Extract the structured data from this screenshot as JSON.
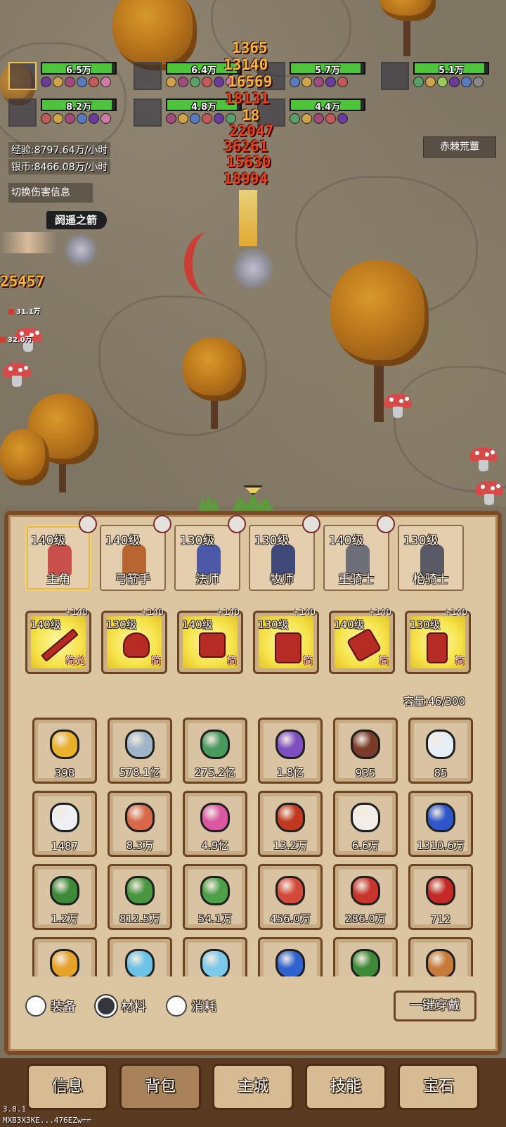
{
  "heroes": [
    {
      "hp": "6.5万",
      "fill": 0.95,
      "selected": true
    },
    {
      "hp": "6.4万",
      "fill": 0.95,
      "selected": false
    },
    {
      "hp": "5.7万",
      "fill": 0.95,
      "selected": false
    },
    {
      "hp": "5.1万",
      "fill": 0.95,
      "selected": false
    },
    {
      "hp": "8.2万",
      "fill": 0.95,
      "selected": false
    },
    {
      "hp": "4.8万",
      "fill": 0.95,
      "selected": false
    },
    {
      "hp": "4.4万",
      "fill": 0.95,
      "selected": false
    }
  ],
  "stats": {
    "exp": "经验:8797.64万/小时",
    "silver": "银币:8466.08万/小时"
  },
  "zone": "赤棘荒蕈",
  "switch_damage": "切换伤害信息",
  "skill_name": "阏遥之箭",
  "damage_numbers": [
    "1365",
    "13140",
    "16569",
    "18131",
    "18",
    "22047",
    "36261",
    "15630",
    "18994",
    "25457"
  ],
  "enemy_hp": [
    "31.1万",
    "32.0万"
  ],
  "roles": [
    {
      "level": "140级",
      "name": "主角",
      "selected": true,
      "color": "#c9504a"
    },
    {
      "level": "140级",
      "name": "弓箭手",
      "selected": false,
      "color": "#b7662f"
    },
    {
      "level": "130级",
      "name": "法师",
      "selected": false,
      "color": "#4a5aa8"
    },
    {
      "level": "130级",
      "name": "牧师",
      "selected": false,
      "color": "#3f4a7a"
    },
    {
      "level": "140级",
      "name": "重骑士",
      "selected": false,
      "color": "#6e6e78"
    },
    {
      "level": "130级",
      "name": "枪骑士",
      "selected": false,
      "color": "#5a5a66"
    }
  ],
  "equipment": [
    {
      "level": "140级",
      "plus": "+140",
      "tag": "简光",
      "icon": "sword-icon"
    },
    {
      "level": "130级",
      "plus": "+140",
      "tag": "简",
      "icon": "helmet-icon"
    },
    {
      "level": "140级",
      "plus": "+140",
      "tag": "简",
      "icon": "armor-icon"
    },
    {
      "level": "130级",
      "plus": "+140",
      "tag": "简",
      "icon": "leggings-icon"
    },
    {
      "level": "140级",
      "plus": "+140",
      "tag": "简",
      "icon": "gloves-icon"
    },
    {
      "level": "130级",
      "plus": "+140",
      "tag": "简",
      "icon": "boots-icon"
    }
  ],
  "capacity": "容量:46/300",
  "bag": [
    {
      "count": "398",
      "icon": "gold-coin-icon",
      "color": "#e9b12c"
    },
    {
      "count": "578.1亿",
      "icon": "silver-coin-icon",
      "color": "#9fb6c9"
    },
    {
      "count": "275.2亿",
      "icon": "green-orb-icon",
      "color": "#4a9a5e"
    },
    {
      "count": "1.8亿",
      "icon": "purple-crystal-icon",
      "color": "#7f4fc2"
    },
    {
      "count": "935",
      "icon": "wood-icon",
      "color": "#7a3b2a"
    },
    {
      "count": "85",
      "icon": "fang-icon",
      "color": "#e8eef7"
    },
    {
      "count": "1487",
      "icon": "feather-icon",
      "color": "#eef0f4"
    },
    {
      "count": "8.3万",
      "icon": "leather-icon",
      "color": "#d7684a"
    },
    {
      "count": "4.9亿",
      "icon": "pink-rune-icon",
      "color": "#d958a0"
    },
    {
      "count": "13.2万",
      "icon": "fire-orb-icon",
      "color": "#c0391f"
    },
    {
      "count": "6.6万",
      "icon": "cow-icon",
      "color": "#f1eee8"
    },
    {
      "count": "1310.6万",
      "icon": "blue-ore-icon",
      "color": "#2f57c9"
    },
    {
      "count": "1.2万",
      "icon": "green-stone-icon",
      "color": "#3c8a3a"
    },
    {
      "count": "812.5万",
      "icon": "green-stone-icon",
      "color": "#48963f"
    },
    {
      "count": "54.1万",
      "icon": "green-stone-icon",
      "color": "#4ea048"
    },
    {
      "count": "456.0万",
      "icon": "red-stone-icon",
      "color": "#d34a3a"
    },
    {
      "count": "286.0万",
      "icon": "red-stone-icon",
      "color": "#c8352c"
    },
    {
      "count": "712",
      "icon": "red-stone-icon",
      "color": "#c42a25"
    },
    {
      "count": "",
      "icon": "amber-stone-icon",
      "color": "#e7a22a"
    },
    {
      "count": "",
      "icon": "cyan-stone-icon",
      "color": "#6cc3e8"
    },
    {
      "count": "",
      "icon": "cyan-stone-icon",
      "color": "#7cc9ea"
    },
    {
      "count": "",
      "icon": "blue-stone-icon",
      "color": "#2f62cf"
    },
    {
      "count": "",
      "icon": "eye-orb-icon",
      "color": "#3f8a3a"
    },
    {
      "count": "",
      "icon": "horse-icon",
      "color": "#c87a3a"
    }
  ],
  "filters": [
    {
      "label": "装备",
      "on": false
    },
    {
      "label": "材料",
      "on": true
    },
    {
      "label": "消耗",
      "on": false
    }
  ],
  "equip_all": "一键穿戴",
  "nav": [
    {
      "label": "信息",
      "active": false
    },
    {
      "label": "背包",
      "active": true
    },
    {
      "label": "主城",
      "active": false
    },
    {
      "label": "技能",
      "active": false
    },
    {
      "label": "宝石",
      "active": false
    }
  ],
  "version": "3.8.1",
  "device_code": "MXB3X3KE...476EZw=="
}
